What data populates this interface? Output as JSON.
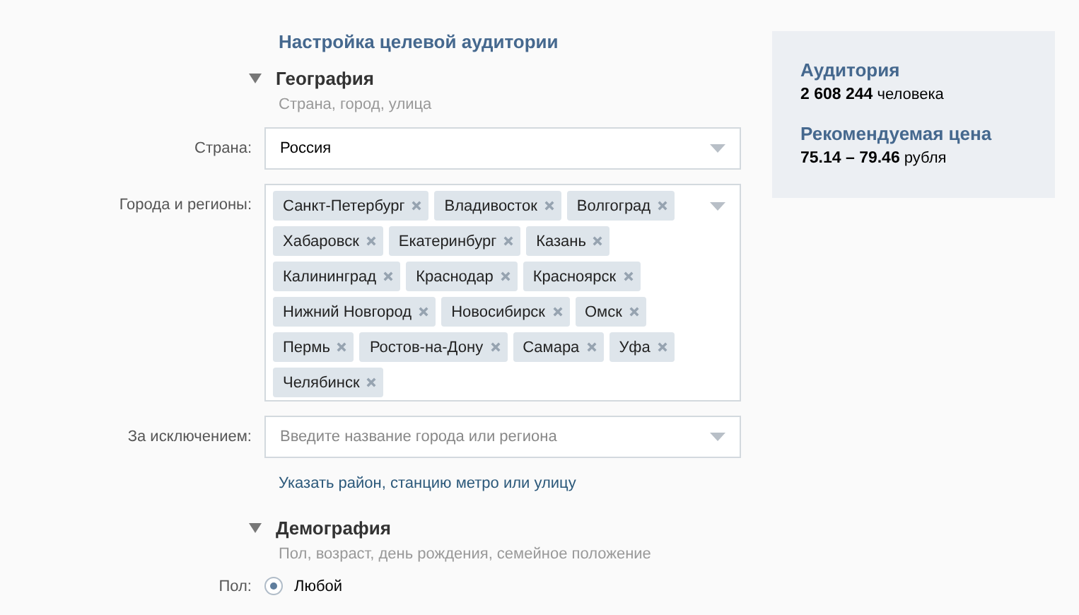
{
  "title": "Настройка целевой аудитории",
  "geography": {
    "title": "География",
    "expanded": true,
    "subtitle": "Страна, город, улица",
    "country": {
      "label": "Страна:",
      "value": "Россия"
    },
    "cities": {
      "label": "Города и регионы:",
      "tags": [
        "Санкт-Петербург",
        "Владивосток",
        "Волгоград",
        "Хабаровск",
        "Екатеринбург",
        "Казань",
        "Калининград",
        "Краснодар",
        "Красноярск",
        "Нижний Новгород",
        "Новосибирск",
        "Омск",
        "Пермь",
        "Ростов-на-Дону",
        "Самара",
        "Уфа",
        "Челябинск"
      ]
    },
    "exclude": {
      "label": "За исключением:",
      "placeholder": "Введите название города или региона"
    },
    "detail_link": "Указать район, станцию метро или улицу"
  },
  "demography": {
    "title": "Демография",
    "expanded": true,
    "subtitle": "Пол, возраст, день рождения, семейное положение",
    "gender": {
      "label": "Пол:",
      "options": [
        {
          "label": "Любой",
          "selected": true
        }
      ]
    }
  },
  "summary": {
    "audience_title": "Аудитория",
    "audience_count": "2 608 244",
    "audience_unit": "человека",
    "price_title": "Рекомендуемая цена",
    "price_range": "75.14 – 79.46",
    "price_unit": "рубля"
  }
}
